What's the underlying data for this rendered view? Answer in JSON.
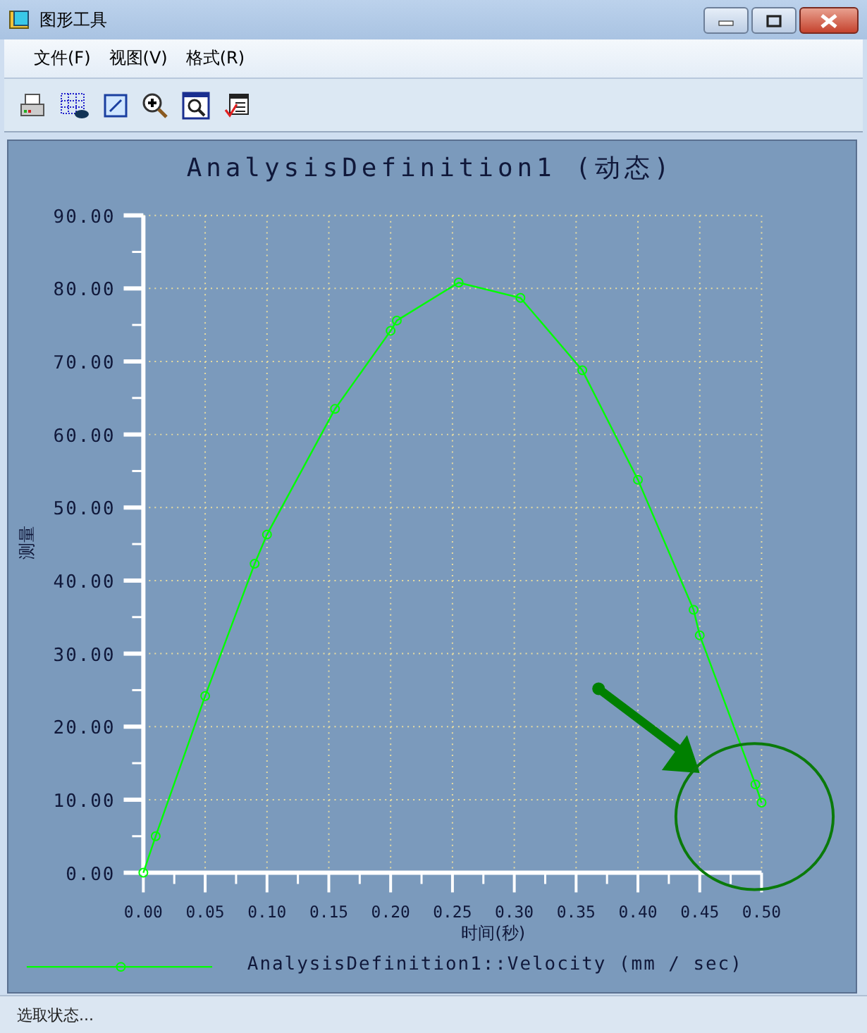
{
  "window": {
    "title": "图形工具"
  },
  "menu": [
    {
      "label": "文件(F)"
    },
    {
      "label": "视图(V)"
    },
    {
      "label": "格式(R)"
    }
  ],
  "chart": {
    "chart_data": {
      "type": "line",
      "title": "AnalysisDefinition1 (动态)",
      "xlabel": "时间(秒)",
      "ylabel": "测量",
      "x": [
        0,
        0.01,
        0.05,
        0.09,
        0.1,
        0.155,
        0.2,
        0.205,
        0.255,
        0.305,
        0.355,
        0.4,
        0.445,
        0.45,
        0.495,
        0.5
      ],
      "grid": true,
      "series": [
        {
          "name": "AnalysisDefinition1::Velocity (mm / sec)",
          "color": "#00ff00",
          "marker": "circle",
          "values": [
            0,
            5,
            24.2,
            42.3,
            46.3,
            63.5,
            74.2,
            75.6,
            80.8,
            78.7,
            68.8,
            53.8,
            36,
            32.5,
            12.1,
            9.6
          ]
        }
      ],
      "xlim": [
        0,
        0.5
      ],
      "ylim": [
        0,
        90
      ],
      "xticks": [
        {
          "value": 0,
          "label": "0.00"
        },
        {
          "value": 0.05,
          "label": "0.05"
        },
        {
          "value": 0.1,
          "label": "0.10"
        },
        {
          "value": 0.15,
          "label": "0.15"
        },
        {
          "value": 0.2,
          "label": "0.20"
        },
        {
          "value": 0.25,
          "label": "0.25"
        },
        {
          "value": 0.3,
          "label": "0.30"
        },
        {
          "value": 0.35,
          "label": "0.35"
        },
        {
          "value": 0.4,
          "label": "0.40"
        },
        {
          "value": 0.45,
          "label": "0.45"
        },
        {
          "value": 0.5,
          "label": "0.50"
        }
      ],
      "yticks": [
        {
          "value": 0,
          "label": "0.00"
        },
        {
          "value": 10,
          "label": "10.00"
        },
        {
          "value": 20,
          "label": "20.00"
        },
        {
          "value": 30,
          "label": "30.00"
        },
        {
          "value": 40,
          "label": "40.00"
        },
        {
          "value": 50,
          "label": "50.00"
        },
        {
          "value": 60,
          "label": "60.00"
        },
        {
          "value": 70,
          "label": "70.00"
        },
        {
          "value": 80,
          "label": "80.00"
        },
        {
          "value": 90,
          "label": "90.00"
        }
      ]
    }
  },
  "status_bar": {
    "text": "选取状态..."
  }
}
